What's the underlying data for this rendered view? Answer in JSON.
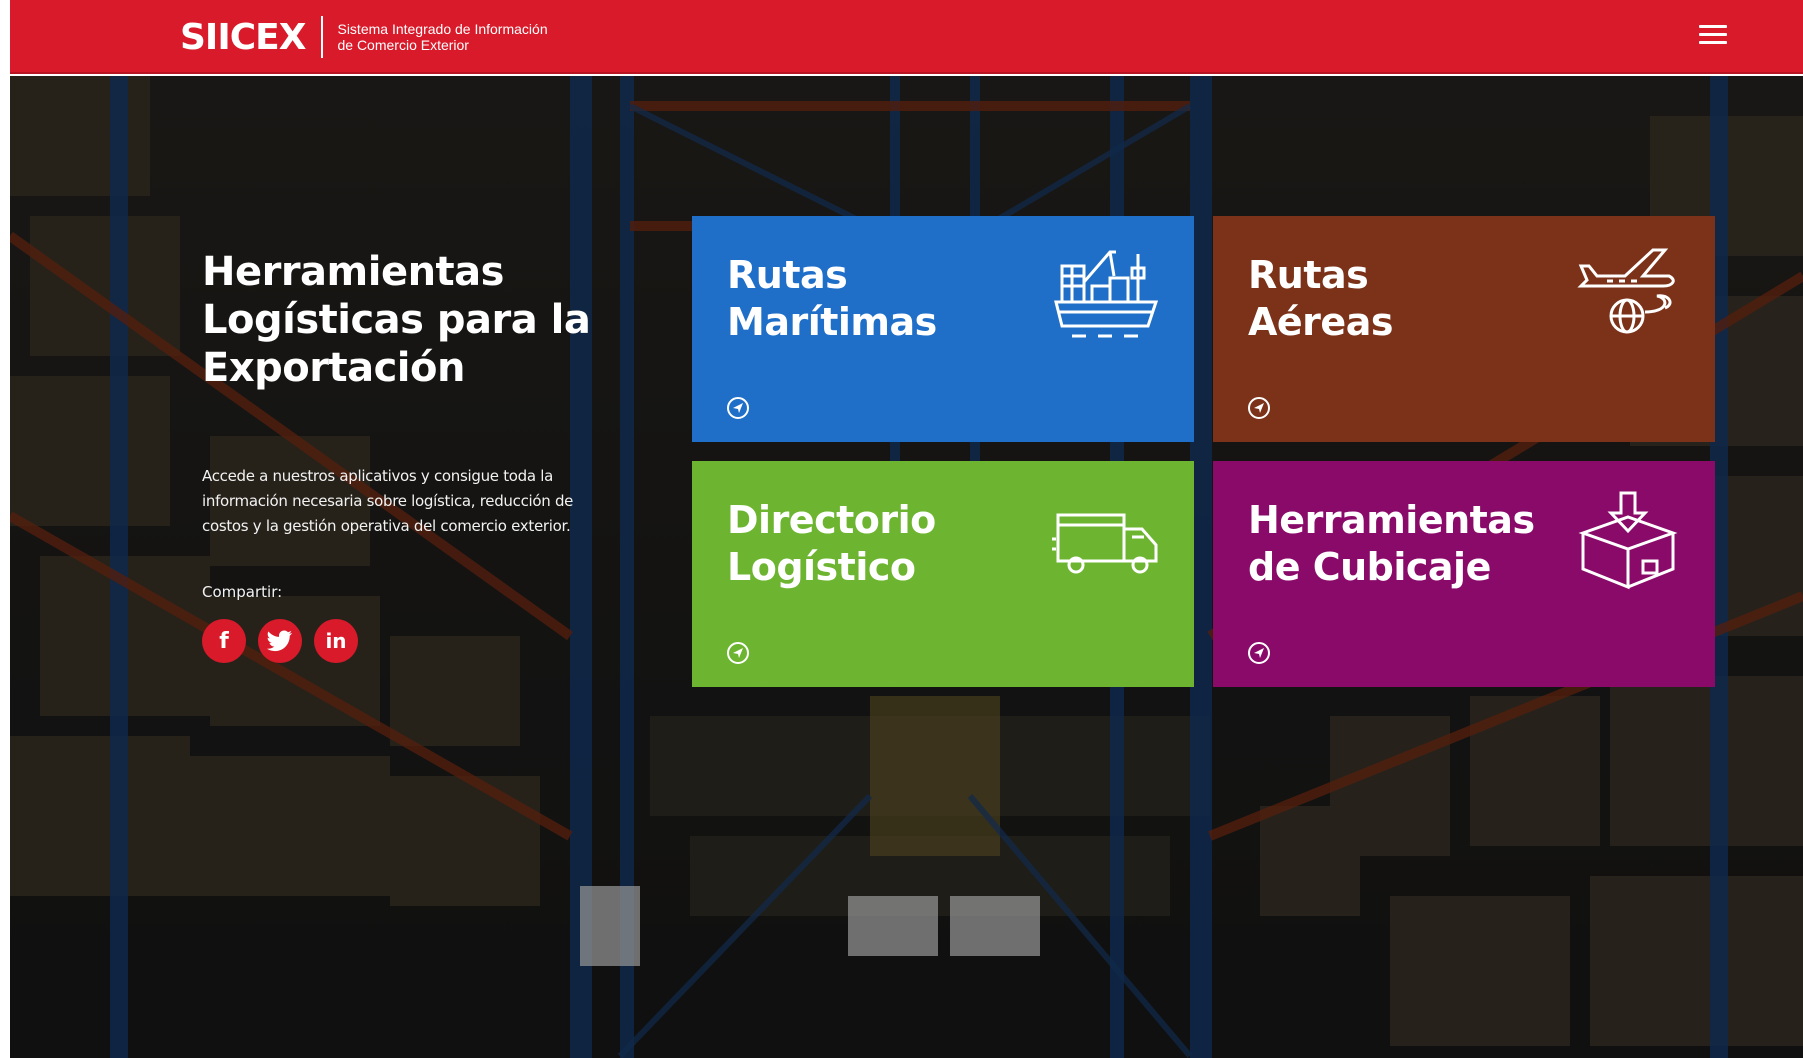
{
  "header": {
    "brand": "SIICEX",
    "subtitle_line1": "Sistema Integrado de Información",
    "subtitle_line2": "de Comercio Exterior",
    "menu_icon": "hamburger-menu-icon"
  },
  "intro": {
    "heading_line1": "Herramientas",
    "heading_line2": "Logísticas para la",
    "heading_line3": "Exportación",
    "desc_line1": "Accede a nuestros aplicativos y consigue toda la",
    "desc_line2": "información necesaria sobre logística, reducción de",
    "desc_line3": "costos y la gestión operativa del comercio exterior.",
    "share_label": "Compartir:",
    "social": [
      {
        "label": "f",
        "icon": "facebook-icon"
      },
      {
        "label": "twitter",
        "icon": "twitter-icon"
      },
      {
        "label": "in",
        "icon": "linkedin-icon"
      }
    ]
  },
  "tiles": [
    {
      "line1": "Rutas",
      "line2": "Marítimas",
      "icon": "cargo-ship-icon",
      "color": "#1f6fc9"
    },
    {
      "line1": "Rutas",
      "line2": "Aéreas",
      "icon": "airplane-globe-icon",
      "color": "#7b3219"
    },
    {
      "line1": "Directorio",
      "line2": "Logístico",
      "icon": "truck-icon",
      "color": "#6db531"
    },
    {
      "line1": "Herramientas",
      "line2": "de Cubicaje",
      "icon": "box-download-icon",
      "color": "#8a0a69"
    }
  ],
  "colors": {
    "brand_red": "#d91a2a"
  }
}
